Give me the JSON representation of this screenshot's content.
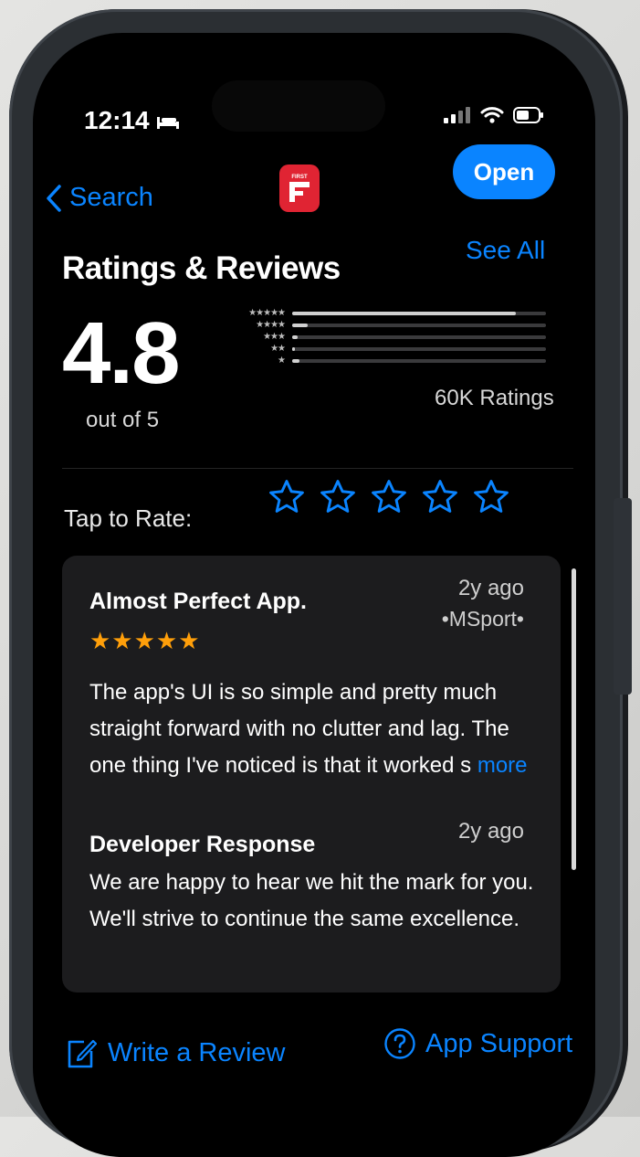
{
  "status_bar": {
    "time": "12:14"
  },
  "nav": {
    "back_label": "Search",
    "open_label": "Open",
    "app_icon_text": "FIRST"
  },
  "ratings": {
    "section_title": "Ratings & Reviews",
    "see_all_label": "See All",
    "average": "4.8",
    "out_of": "out of 5",
    "ratings_count": "60K Ratings",
    "distribution": [
      {
        "stars": "★★★★★",
        "fraction": 0.88
      },
      {
        "stars": "★★★★",
        "fraction": 0.06
      },
      {
        "stars": "★★★",
        "fraction": 0.02
      },
      {
        "stars": "★★",
        "fraction": 0.01
      },
      {
        "stars": "★",
        "fraction": 0.03
      }
    ]
  },
  "tap_to_rate": {
    "label": "Tap to Rate:"
  },
  "review": {
    "title": "Almost Perfect App.",
    "date": "2y ago",
    "author": "•MSport•",
    "stars": "★★★★★",
    "rating": 5,
    "body": "The app's UI is so simple and pretty much straight forward with no clutter and lag. The one thing I've noticed is that it worked s",
    "more_label": "more",
    "developer_response": {
      "title": "Developer Response",
      "date": "2y ago",
      "body": "We are happy to hear we hit the mark for you. We'll strive to continue the same excellence."
    }
  },
  "footer": {
    "write_review_label": "Write a Review",
    "app_support_label": "App Support"
  },
  "colors": {
    "accent": "#0a84ff",
    "star": "#ff9f0a",
    "card": "#1c1c1e",
    "brand": "#e02433"
  }
}
